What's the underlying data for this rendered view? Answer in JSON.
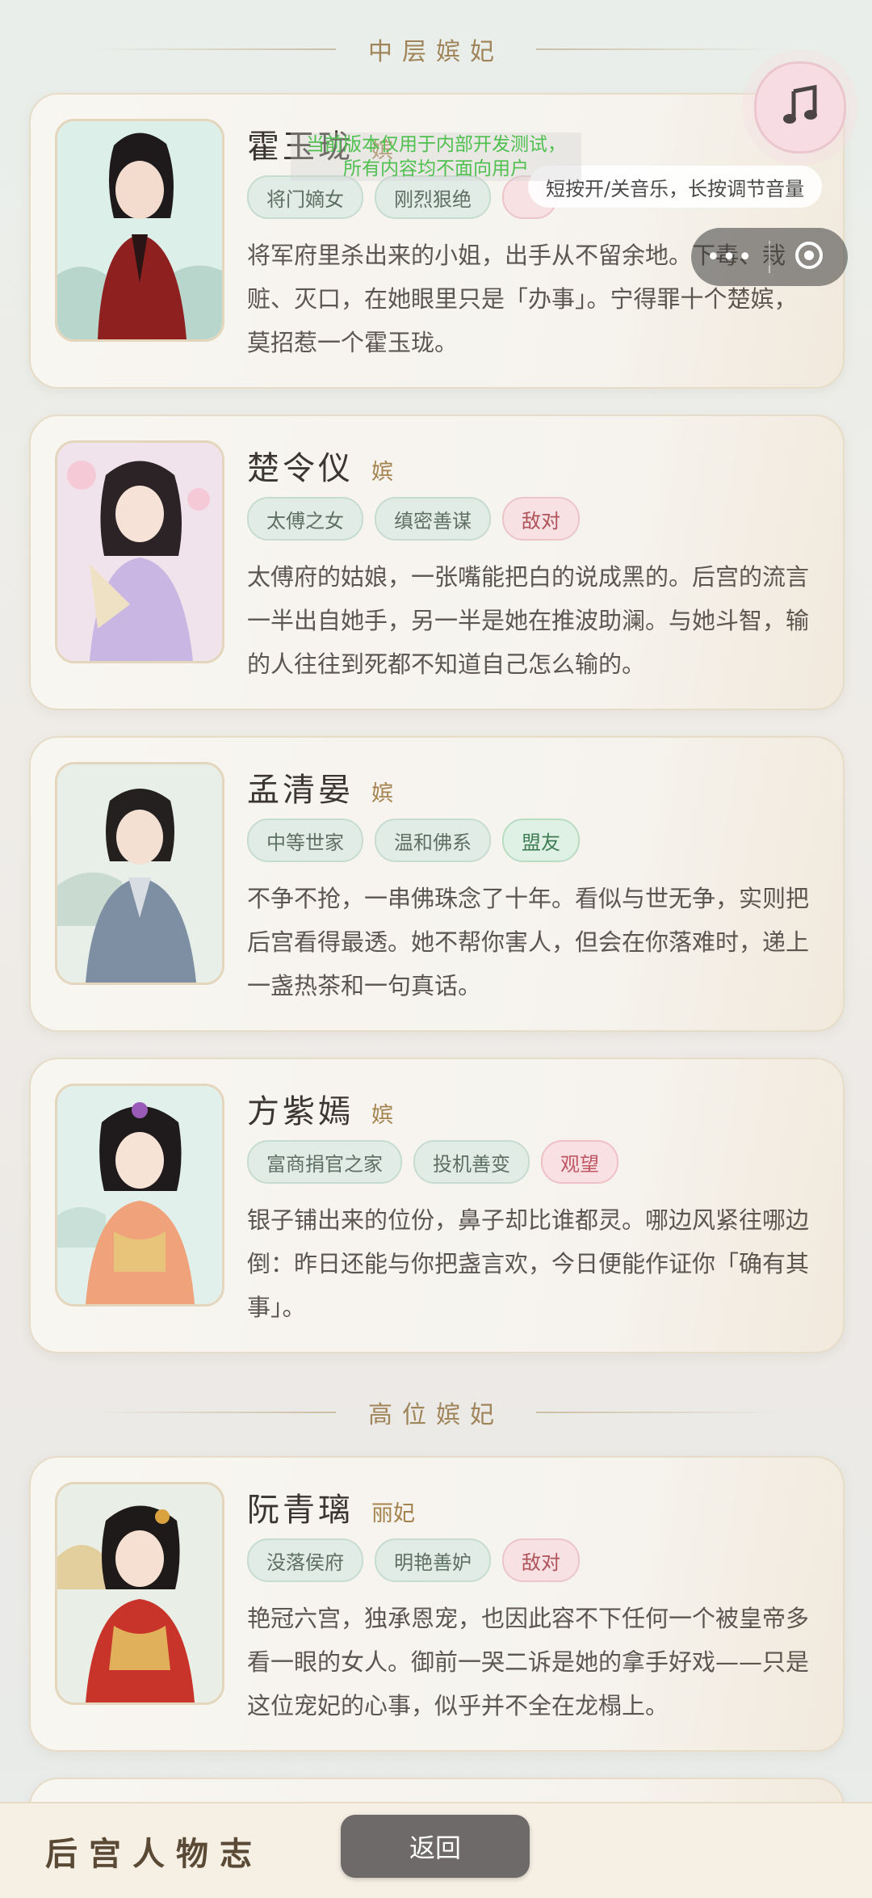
{
  "sections": {
    "middle": "中层嫔妃",
    "high": "高位嫔妃"
  },
  "cards": [
    {
      "name": "霍玉珑",
      "rank": "嫔",
      "tags": [
        "将门嫡女",
        "刚烈狠绝"
      ],
      "desc": "将军府里杀出来的小姐，出手从不留余地。下毒、栽赃、灭口，在她眼里只是「办事」。宁得罪十个楚嫔，莫招惹一个霍玉珑。"
    },
    {
      "name": "楚令仪",
      "rank": "嫔",
      "tags": [
        "太傅之女",
        "缜密善谋",
        "敌对"
      ],
      "desc": "太傅府的姑娘，一张嘴能把白的说成黑的。后宫的流言一半出自她手，另一半是她在推波助澜。与她斗智，输的人往往到死都不知道自己怎么输的。"
    },
    {
      "name": "孟清晏",
      "rank": "嫔",
      "tags": [
        "中等世家",
        "温和佛系",
        "盟友"
      ],
      "desc": "不争不抢，一串佛珠念了十年。看似与世无争，实则把后宫看得最透。她不帮你害人，但会在你落难时，递上一盏热茶和一句真话。"
    },
    {
      "name": "方紫嫣",
      "rank": "嫔",
      "tags": [
        "富商捐官之家",
        "投机善变",
        "观望"
      ],
      "desc": "银子铺出来的位份，鼻子却比谁都灵。哪边风紧往哪边倒：昨日还能与你把盏言欢，今日便能作证你「确有其事」。"
    },
    {
      "name": "阮青璃",
      "rank": "丽妃",
      "tags": [
        "没落侯府",
        "明艳善妒",
        "敌对"
      ],
      "desc": "艳冠六宫，独承恩宠，也因此容不下任何一个被皇帝多看一眼的女人。御前一哭二诉是她的拿手好戏——只是这位宠妃的心事，似乎并不全在龙榻上。"
    }
  ],
  "overlay": {
    "music_hint": "短按开/关音乐，长按调节音量",
    "dev_notice_line1": "当前版本仅用于内部开发测试，",
    "dev_notice_line2": "所有内容均不面向用户",
    "capsule_more": "•••"
  },
  "bottom": {
    "title": "后宫人物志",
    "back_label": "返回"
  },
  "icons": {
    "music": "music-note-icon",
    "close": "circle-close-icon"
  },
  "colors": {
    "accent_gold": "#a0845a",
    "tag_enemy": "#b0525a",
    "tag_ally": "#3f7d55",
    "tag_watch": "#c05563"
  }
}
